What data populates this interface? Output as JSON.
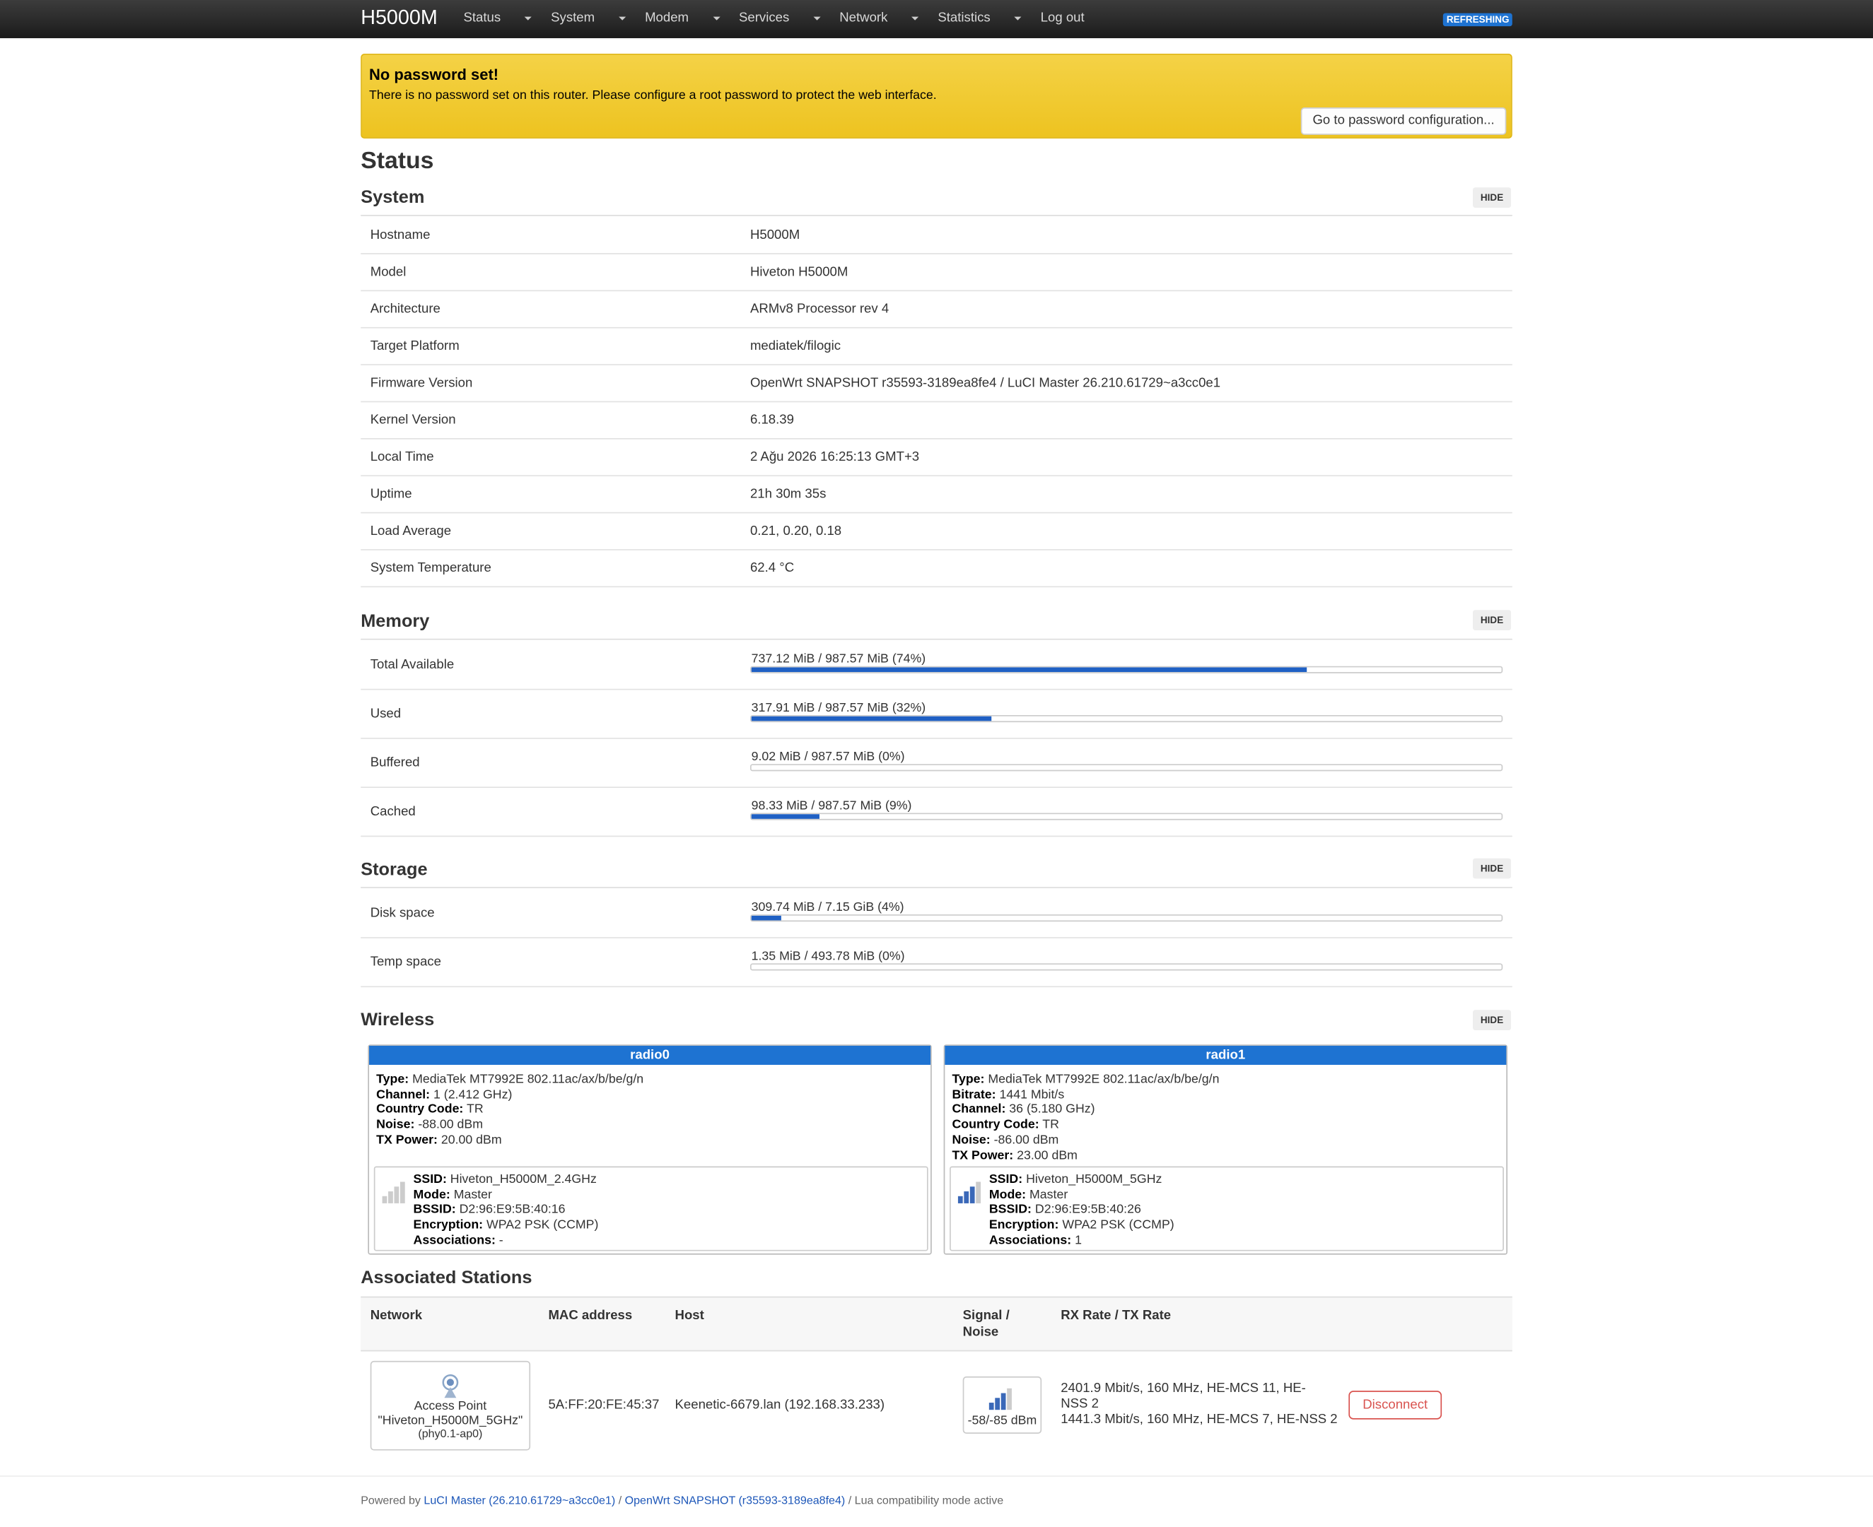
{
  "nav": {
    "brand": "H5000M",
    "menu": [
      "Status",
      "System",
      "Modem",
      "Services",
      "Network",
      "Statistics"
    ],
    "logout": "Log out",
    "badge": "REFRESHING"
  },
  "alert": {
    "title": "No password set!",
    "text": "There is no password set on this router. Please configure a root password to protect the web interface.",
    "button": "Go to password configuration..."
  },
  "page_title": "Status",
  "hide_label": "HIDE",
  "system": {
    "title": "System",
    "rows": [
      {
        "k": "Hostname",
        "v": "H5000M"
      },
      {
        "k": "Model",
        "v": "Hiveton H5000M"
      },
      {
        "k": "Architecture",
        "v": "ARMv8 Processor rev 4"
      },
      {
        "k": "Target Platform",
        "v": "mediatek/filogic"
      },
      {
        "k": "Firmware Version",
        "v": "OpenWrt SNAPSHOT r35593-3189ea8fe4 / LuCI Master 26.210.61729~a3cc0e1"
      },
      {
        "k": "Kernel Version",
        "v": "6.18.39"
      },
      {
        "k": "Local Time",
        "v": "2 Ağu 2026 16:25:13 GMT+3"
      },
      {
        "k": "Uptime",
        "v": "21h 30m 35s"
      },
      {
        "k": "Load Average",
        "v": "0.21, 0.20, 0.18"
      },
      {
        "k": "System Temperature",
        "v": "62.4 °C"
      }
    ]
  },
  "memory": {
    "title": "Memory",
    "rows": [
      {
        "k": "Total Available",
        "v": "737.12 MiB / 987.57 MiB (74%)",
        "pct": 74
      },
      {
        "k": "Used",
        "v": "317.91 MiB / 987.57 MiB (32%)",
        "pct": 32
      },
      {
        "k": "Buffered",
        "v": "9.02 MiB / 987.57 MiB (0%)",
        "pct": 0
      },
      {
        "k": "Cached",
        "v": "98.33 MiB / 987.57 MiB (9%)",
        "pct": 9
      }
    ]
  },
  "storage": {
    "title": "Storage",
    "rows": [
      {
        "k": "Disk space",
        "v": "309.74 MiB / 7.15 GiB (4%)",
        "pct": 4
      },
      {
        "k": "Temp space",
        "v": "1.35 MiB / 493.78 MiB (0%)",
        "pct": 0
      }
    ]
  },
  "wireless": {
    "title": "Wireless",
    "radios": [
      {
        "name": "radio0",
        "info": [
          {
            "k": "Type:",
            "v": "MediaTek MT7992E 802.11ac/ax/b/be/g/n"
          },
          {
            "k": "Channel:",
            "v": "1 (2.412 GHz)"
          },
          {
            "k": "Country Code:",
            "v": "TR"
          },
          {
            "k": "Noise:",
            "v": "-88.00 dBm"
          },
          {
            "k": "TX Power:",
            "v": "20.00 dBm"
          }
        ],
        "ssid": [
          {
            "k": "SSID:",
            "v": "Hiveton_H5000M_2.4GHz"
          },
          {
            "k": "Mode:",
            "v": "Master"
          },
          {
            "k": "BSSID:",
            "v": "D2:96:E9:5B:40:16"
          },
          {
            "k": "Encryption:",
            "v": "WPA2 PSK (CCMP)"
          },
          {
            "k": "Associations:",
            "v": "-"
          }
        ],
        "signal_level": 0
      },
      {
        "name": "radio1",
        "info": [
          {
            "k": "Type:",
            "v": "MediaTek MT7992E 802.11ac/ax/b/be/g/n"
          },
          {
            "k": "Bitrate:",
            "v": "1441 Mbit/s"
          },
          {
            "k": "Channel:",
            "v": "36 (5.180 GHz)"
          },
          {
            "k": "Country Code:",
            "v": "TR"
          },
          {
            "k": "Noise:",
            "v": "-86.00 dBm"
          },
          {
            "k": "TX Power:",
            "v": "23.00 dBm"
          }
        ],
        "ssid": [
          {
            "k": "SSID:",
            "v": "Hiveton_H5000M_5GHz"
          },
          {
            "k": "Mode:",
            "v": "Master"
          },
          {
            "k": "BSSID:",
            "v": "D2:96:E9:5B:40:26"
          },
          {
            "k": "Encryption:",
            "v": "WPA2 PSK (CCMP)"
          },
          {
            "k": "Associations:",
            "v": "1"
          }
        ],
        "signal_level": 3
      }
    ]
  },
  "stations": {
    "title": "Associated Stations",
    "headers": {
      "network": "Network",
      "mac": "MAC address",
      "host": "Host",
      "signal": "Signal /",
      "noise": "Noise",
      "rate": "RX Rate / TX Rate"
    },
    "row": {
      "ap_line1": "Access Point",
      "ap_line2": "\"Hiveton_H5000M_5GHz\"",
      "ap_line3": "(phy0.1-ap0)",
      "mac": "5A:FF:20:FE:45:37",
      "host": "Keenetic-6679.lan (192.168.33.233)",
      "signal": "-58/-85 dBm",
      "rx1": "2401.9 Mbit/s, 160 MHz, HE-MCS 11, HE-",
      "rx2": "NSS 2",
      "tx": "1441.3 Mbit/s, 160 MHz, HE-MCS 7, HE-NSS 2",
      "disconnect": "Disconnect"
    }
  },
  "footer": {
    "prefix": "Powered by",
    "luci": "LuCI Master (26.210.61729~a3cc0e1)",
    "sep": "/",
    "openwrt": "OpenWrt SNAPSHOT (r35593-3189ea8fe4)",
    "suffix": "/ Lua compatibility mode active"
  }
}
